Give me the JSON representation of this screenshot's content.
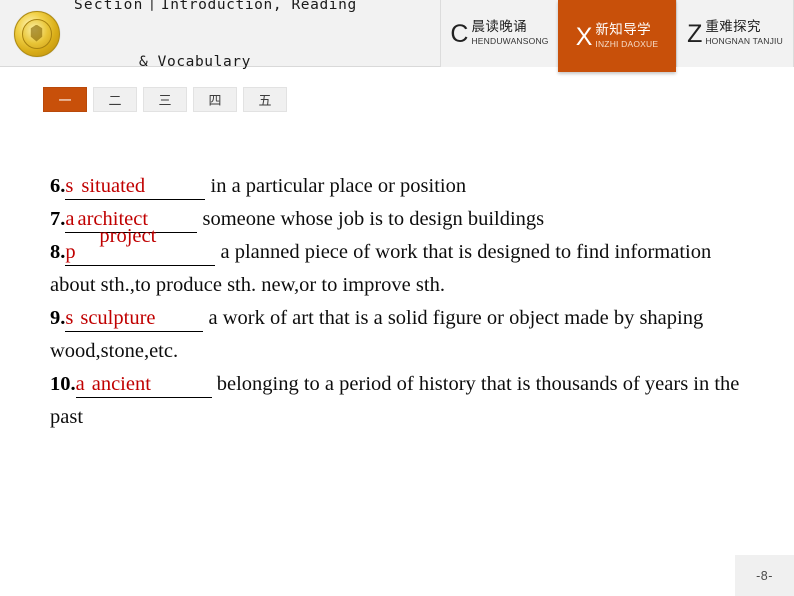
{
  "header": {
    "emblem_icon": "school-emblem-icon",
    "section_label": "Section",
    "section_divider": "❘",
    "section_name_line1": "Introduction, Reading",
    "section_name_line2": "& Vocabulary",
    "tabs": [
      {
        "letter": "C",
        "cn": "晨读晚诵",
        "pinyin": "HENDUWANSONG",
        "active": false
      },
      {
        "letter": "X",
        "cn": "新知导学",
        "pinyin": "INZHI DAOXUE",
        "active": true
      },
      {
        "letter": "Z",
        "cn": "重难探究",
        "pinyin": "HONGNAN TANJIU",
        "active": false
      }
    ]
  },
  "number_tabs": [
    {
      "label": "一",
      "active": true
    },
    {
      "label": "二",
      "active": false
    },
    {
      "label": "三",
      "active": false
    },
    {
      "label": "四",
      "active": false
    },
    {
      "label": "五",
      "active": false
    }
  ],
  "exercise": {
    "items": [
      {
        "number": "6.",
        "hint": "s",
        "answer": "situated",
        "definition": " in a particular place or position"
      },
      {
        "number": "7.",
        "hint": "a",
        "answer": "architect",
        "definition": " someone whose job is to design buildings"
      },
      {
        "number": "8.",
        "hint": "p",
        "answer": "project",
        "definition": " a planned piece of work that is designed to find information about sth.,to produce sth. new,or to improve sth."
      },
      {
        "number": "9.",
        "hint": "s",
        "answer": "sculpture",
        "definition": " a work of art that is a solid figure or object made by shaping wood,stone,etc."
      },
      {
        "number": "10.",
        "hint": "a",
        "answer": "ancient",
        "definition": " belonging to a period of history that is thousands of years in the past"
      }
    ]
  },
  "footer": {
    "page_label": "-8-"
  },
  "colors": {
    "accent_orange": "#c8500a",
    "answer_red": "#c00000",
    "header_bg": "#f2f2f2"
  }
}
